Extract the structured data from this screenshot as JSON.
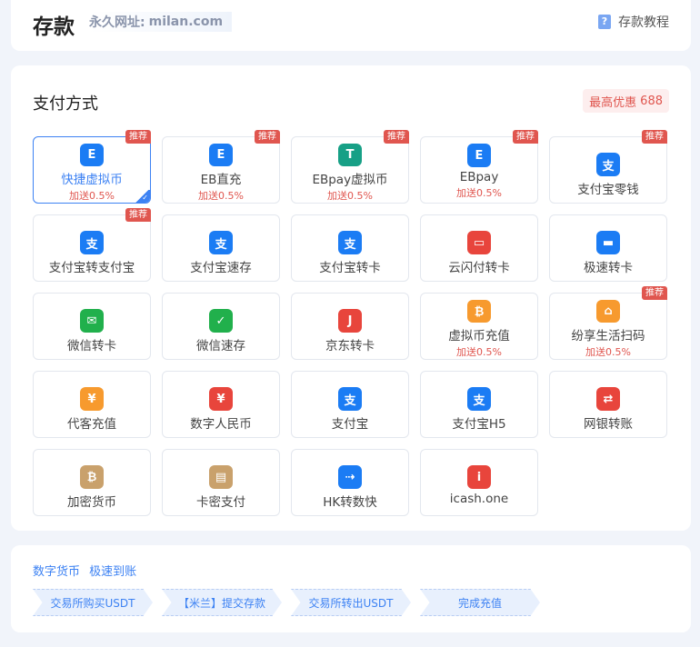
{
  "header": {
    "title": "存款",
    "permalink_label": "永久网址:",
    "permalink_url": "milan.com",
    "tutorial_label": "存款教程"
  },
  "payment": {
    "section_title": "支付方式",
    "max_discount_label": "最高优惠",
    "max_discount_value": "688",
    "methods": [
      {
        "name": "快捷虚拟币",
        "bonus": "加送0.5%",
        "badge": "推荐",
        "icon": "eb-wallet-icon",
        "color": "#1b7cf4",
        "selected": true
      },
      {
        "name": "EB直充",
        "bonus": "加送0.5%",
        "badge": "推荐",
        "icon": "eb-wallet-icon",
        "color": "#1b7cf4"
      },
      {
        "name": "EBpay虚拟币",
        "bonus": "加送0.5%",
        "badge": "推荐",
        "icon": "tether-icon",
        "color": "#17a086"
      },
      {
        "name": "EBpay",
        "bonus": "加送0.5%",
        "badge": "推荐",
        "icon": "eb-wallet-icon",
        "color": "#1b7cf4"
      },
      {
        "name": "支付宝零钱",
        "bonus": "",
        "badge": "推荐",
        "icon": "alipay-icon",
        "color": "#1b7cf4"
      },
      {
        "name": "支付宝转支付宝",
        "bonus": "",
        "badge": "推荐",
        "icon": "alipay-icon",
        "color": "#1b7cf4"
      },
      {
        "name": "支付宝速存",
        "bonus": "",
        "badge": "",
        "icon": "alipay-icon",
        "color": "#1b7cf4"
      },
      {
        "name": "支付宝转卡",
        "bonus": "",
        "badge": "",
        "icon": "alipay-card-icon",
        "color": "#1b7cf4"
      },
      {
        "name": "云闪付转卡",
        "bonus": "",
        "badge": "",
        "icon": "unionpay-icon",
        "color": "#e8453c"
      },
      {
        "name": "极速转卡",
        "bonus": "",
        "badge": "",
        "icon": "bank-card-icon",
        "color": "#1b7cf4"
      },
      {
        "name": "微信转卡",
        "bonus": "",
        "badge": "",
        "icon": "wechat-card-icon",
        "color": "#21b04c"
      },
      {
        "name": "微信速存",
        "bonus": "",
        "badge": "",
        "icon": "wechat-icon",
        "color": "#21b04c"
      },
      {
        "name": "京东转卡",
        "bonus": "",
        "badge": "",
        "icon": "jd-icon",
        "color": "#e8453c"
      },
      {
        "name": "虚拟币充值",
        "bonus": "加送0.5%",
        "badge": "",
        "icon": "bitcoin-icon",
        "color": "#f79a2e"
      },
      {
        "name": "纷享生活扫码",
        "bonus": "加送0.5%",
        "badge": "推荐",
        "icon": "home-icon",
        "color": "#f79a2e"
      },
      {
        "name": "代客充值",
        "bonus": "",
        "badge": "",
        "icon": "hand-coin-icon",
        "color": "#f79a2e"
      },
      {
        "name": "数字人民币",
        "bonus": "",
        "badge": "",
        "icon": "yuan-icon",
        "color": "#e8453c"
      },
      {
        "name": "支付宝",
        "bonus": "",
        "badge": "",
        "icon": "alipay-icon",
        "color": "#1b7cf4"
      },
      {
        "name": "支付宝H5",
        "bonus": "",
        "badge": "",
        "icon": "alipay-icon",
        "color": "#1b7cf4"
      },
      {
        "name": "网银转账",
        "bonus": "",
        "badge": "",
        "icon": "transfer-icon",
        "color": "#e8453c"
      },
      {
        "name": "加密货币",
        "bonus": "",
        "badge": "",
        "icon": "bitcoin-icon",
        "color": "#c9a16c"
      },
      {
        "name": "卡密支付",
        "bonus": "",
        "badge": "",
        "icon": "card-key-icon",
        "color": "#c9a16c"
      },
      {
        "name": "HK转数快",
        "bonus": "",
        "badge": "",
        "icon": "hk-fps-icon",
        "color": "#1b7cf4"
      },
      {
        "name": "icash.one",
        "bonus": "",
        "badge": "",
        "icon": "icash-icon",
        "color": "#e8453c"
      }
    ]
  },
  "steps": {
    "label_a": "数字货币",
    "label_b": "极速到账",
    "items": [
      "交易所购买USDT",
      "【米兰】提交存款",
      "交易所转出USDT",
      "完成充值"
    ]
  }
}
